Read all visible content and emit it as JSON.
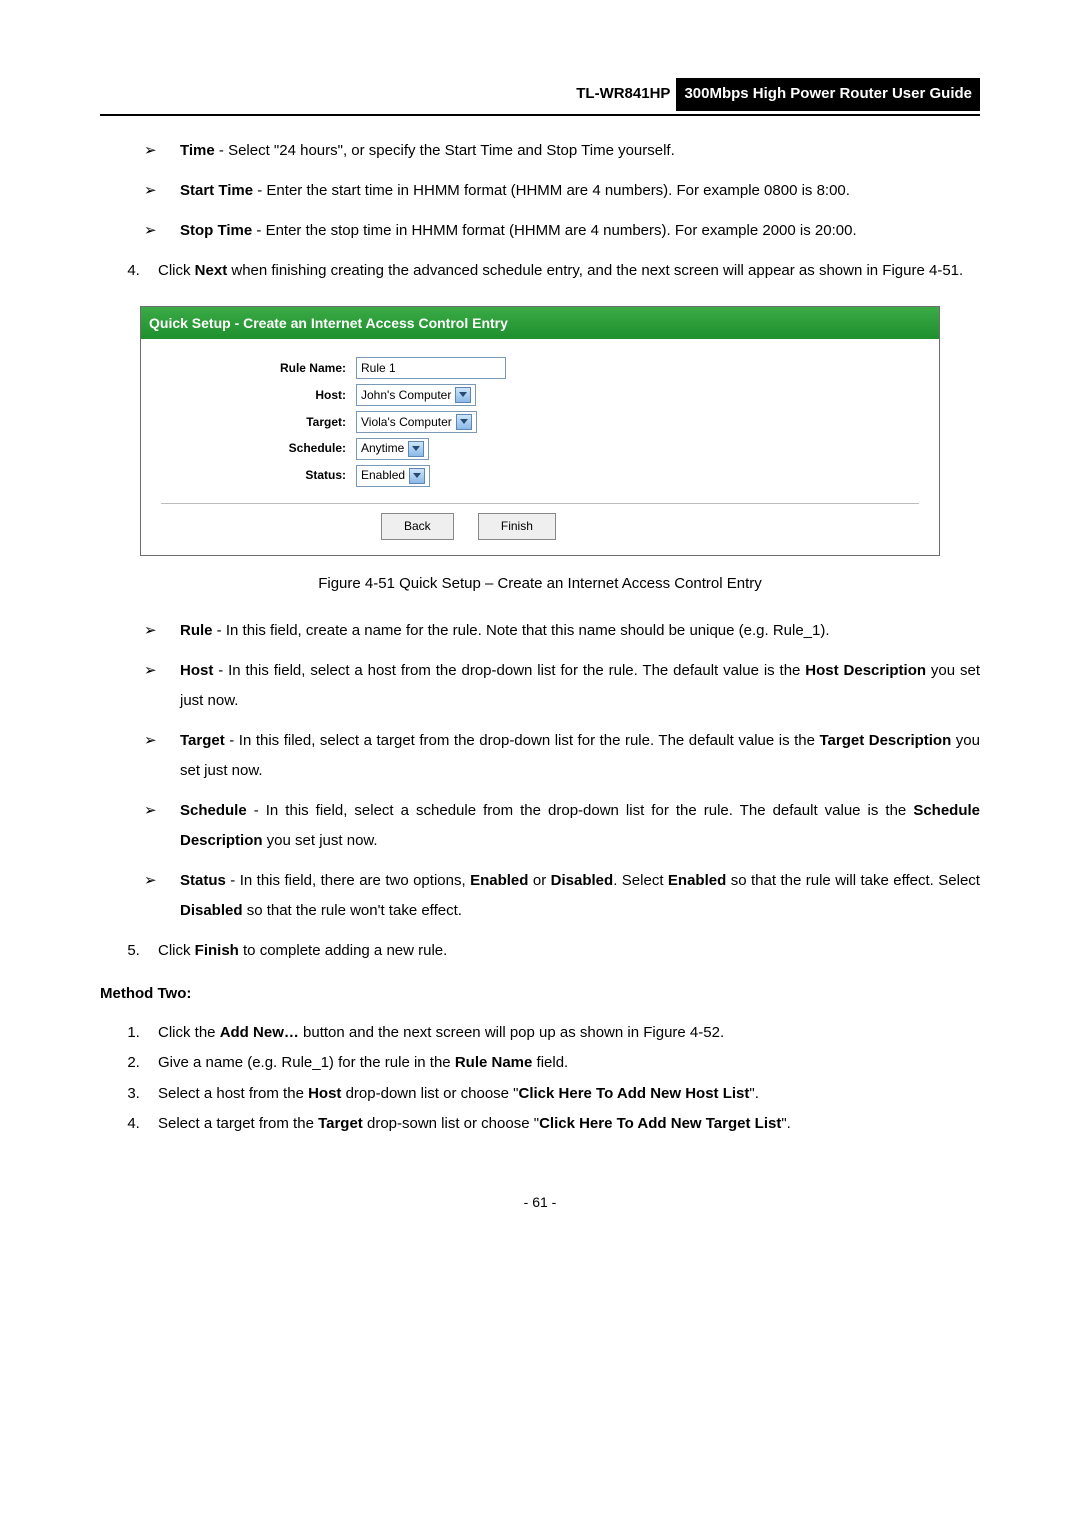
{
  "header": {
    "model": "TL-WR841HP",
    "subtitle": "300Mbps High Power Router User Guide"
  },
  "bullets_top": [
    {
      "bold": "Time",
      "rest": " - Select \"24 hours\", or specify the Start Time and Stop Time yourself."
    },
    {
      "bold": "Start Time",
      "rest": " - Enter the start time in HHMM format (HHMM are 4 numbers). For example 0800 is 8:00."
    },
    {
      "bold": "Stop Time",
      "rest": " - Enter the stop time in HHMM format (HHMM are 4 numbers). For example 2000 is 20:00."
    }
  ],
  "step4": {
    "prefix": "Click ",
    "bold": "Next",
    "rest": " when finishing creating the advanced schedule entry, and the next screen will appear as shown in Figure 4-51."
  },
  "figure": {
    "title": "Quick Setup - Create an Internet Access Control Entry",
    "rows": {
      "rule_name_label": "Rule Name:",
      "rule_name_value": "Rule 1",
      "host_label": "Host:",
      "host_value": "John's Computer",
      "target_label": "Target:",
      "target_value": "Viola's Computer",
      "schedule_label": "Schedule:",
      "schedule_value": "Anytime",
      "status_label": "Status:",
      "status_value": "Enabled"
    },
    "buttons": {
      "back": "Back",
      "finish": "Finish"
    }
  },
  "caption": "Figure 4-51    Quick Setup – Create an Internet Access Control Entry",
  "bullets_bottom": [
    {
      "bold": "Rule",
      "rest": " - In this field, create a name for the rule. Note that this name should be unique (e.g. Rule_1)."
    },
    {
      "bold": "Host",
      "rest_a": " - In this field, select a host from the drop-down list for the rule. The default value is the ",
      "bold2": "Host Description",
      "rest_b": " you set just now."
    },
    {
      "bold": "Target",
      "rest_a": " - In this filed, select a target from the drop-down list for the rule. The default value is the ",
      "bold2": "Target Description",
      "rest_b": " you set just now."
    },
    {
      "bold": "Schedule",
      "rest_a": " - In this field, select a schedule from the drop-down list for the rule. The default value is the ",
      "bold2": "Schedule Description",
      "rest_b": " you set just now."
    },
    {
      "bold": "Status",
      "rest_a": " - In this field, there are two options, ",
      "bold2": "Enabled",
      "rest_b": " or ",
      "bold3": "Disabled",
      "rest_c": ". Select ",
      "bold4": "Enabled",
      "rest_d": " so that the rule will take effect. Select ",
      "bold5": "Disabled",
      "rest_e": " so that the rule won't take effect."
    }
  ],
  "step5": {
    "prefix": "Click ",
    "bold": "Finish",
    "rest": " to complete adding a new rule."
  },
  "method_two_heading": "Method Two:",
  "method_two_steps": {
    "s1_a": "Click the ",
    "s1_b": "Add New…",
    "s1_c": " button and the next screen will pop up as shown in Figure 4-52.",
    "s2_a": "Give a name (e.g. Rule_1) for the rule in the ",
    "s2_b": "Rule Name",
    "s2_c": " field.",
    "s3_a": "Select a host from the ",
    "s3_b": "Host",
    "s3_c": " drop-down list or choose \"",
    "s3_d": "Click Here To Add New Host List",
    "s3_e": "\".",
    "s4_a": "Select a target from the ",
    "s4_b": "Target",
    "s4_c": " drop-sown list or choose \"",
    "s4_d": "Click Here To Add New Target List",
    "s4_e": "\"."
  },
  "page_number": "- 61 -"
}
